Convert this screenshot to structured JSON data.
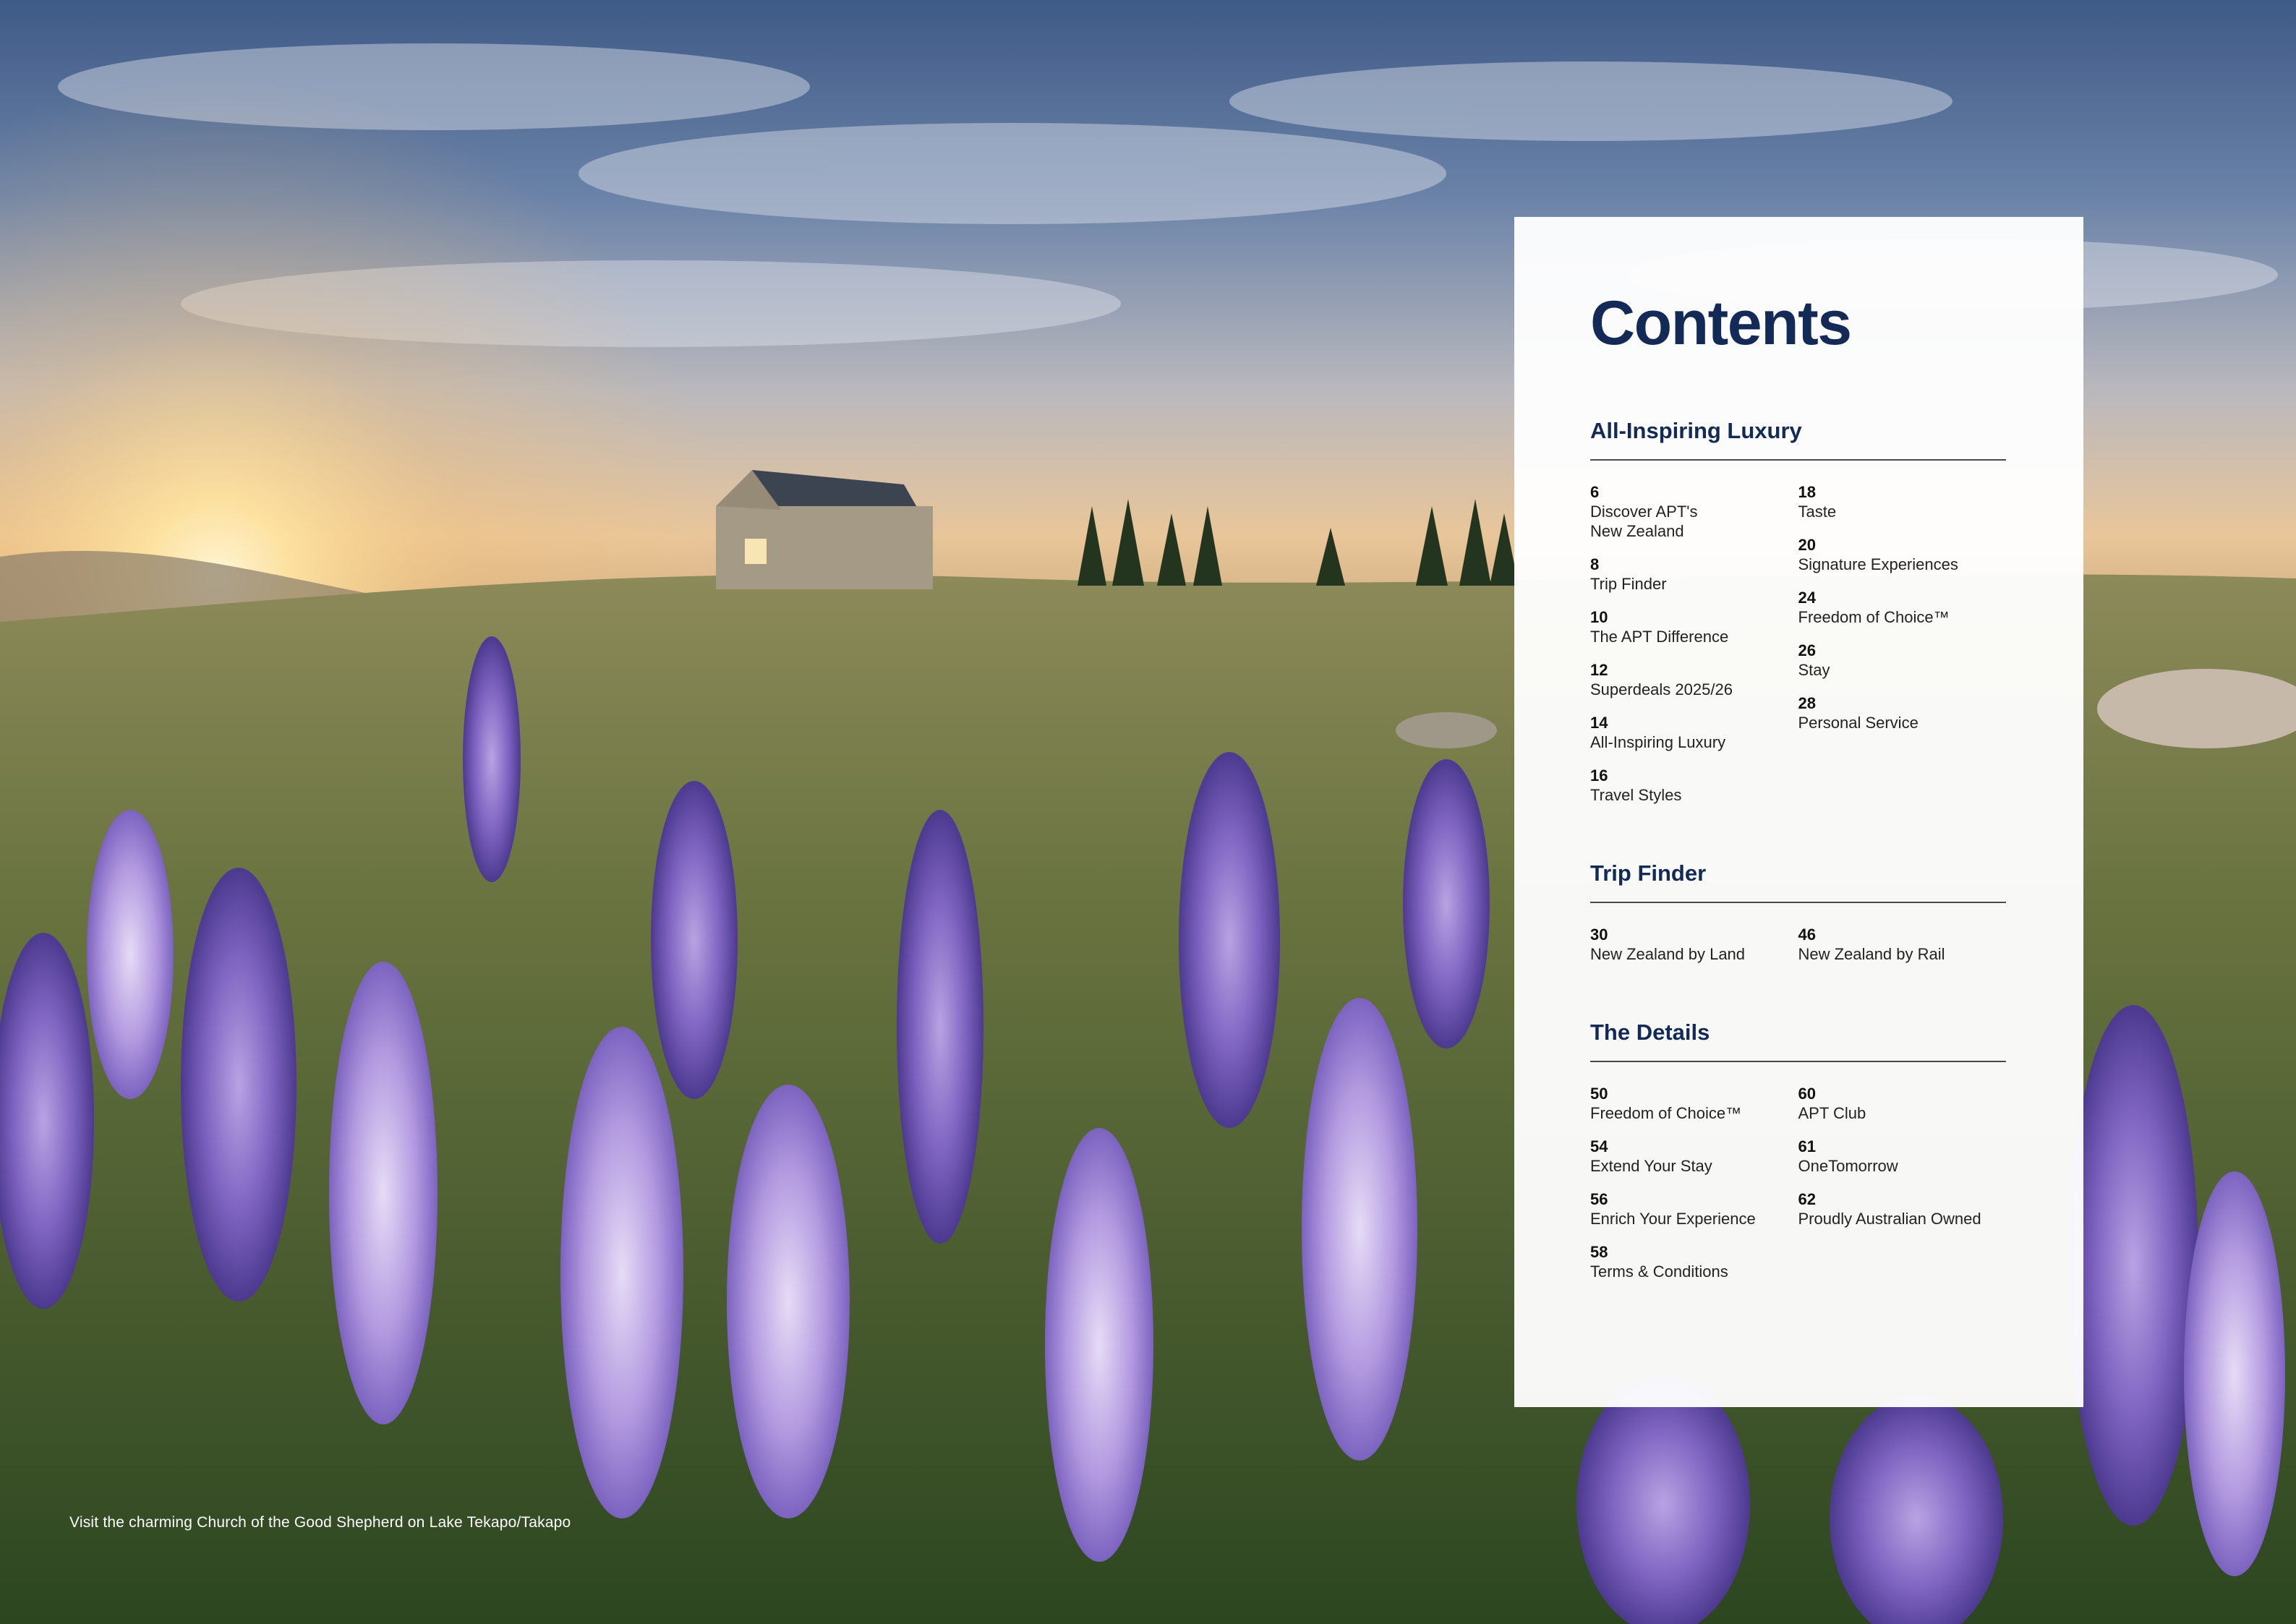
{
  "background": {
    "caption": "Visit the charming Church of the Good Shepherd on Lake Tekapo/Takapo"
  },
  "contents": {
    "title": "Contents",
    "sections": [
      {
        "title": "All-Inspiring Luxury",
        "left": [
          {
            "page": "6",
            "label": "Discover APT's\nNew Zealand"
          },
          {
            "page": "8",
            "label": "Trip Finder"
          },
          {
            "page": "10",
            "label": "The APT Difference"
          },
          {
            "page": "12",
            "label": "Superdeals 2025/26"
          },
          {
            "page": "14",
            "label": "All-Inspiring Luxury"
          },
          {
            "page": "16",
            "label": "Travel Styles"
          }
        ],
        "right": [
          {
            "page": "18",
            "label": "Taste"
          },
          {
            "page": "20",
            "label": "Signature Experiences"
          },
          {
            "page": "24",
            "label": "Freedom of Choice™"
          },
          {
            "page": "26",
            "label": "Stay"
          },
          {
            "page": "28",
            "label": "Personal Service"
          }
        ]
      },
      {
        "title": "Trip Finder",
        "left": [
          {
            "page": "30",
            "label": "New Zealand by Land"
          }
        ],
        "right": [
          {
            "page": "46",
            "label": "New Zealand by Rail"
          }
        ]
      },
      {
        "title": "The Details",
        "left": [
          {
            "page": "50",
            "label": "Freedom of Choice™"
          },
          {
            "page": "54",
            "label": "Extend Your Stay"
          },
          {
            "page": "56",
            "label": "Enrich Your Experience"
          },
          {
            "page": "58",
            "label": "Terms & Conditions"
          }
        ],
        "right": [
          {
            "page": "60",
            "label": "APT Club"
          },
          {
            "page": "61",
            "label": "OneTomorrow"
          },
          {
            "page": "62",
            "label": "Proudly Australian Owned"
          }
        ]
      }
    ]
  }
}
